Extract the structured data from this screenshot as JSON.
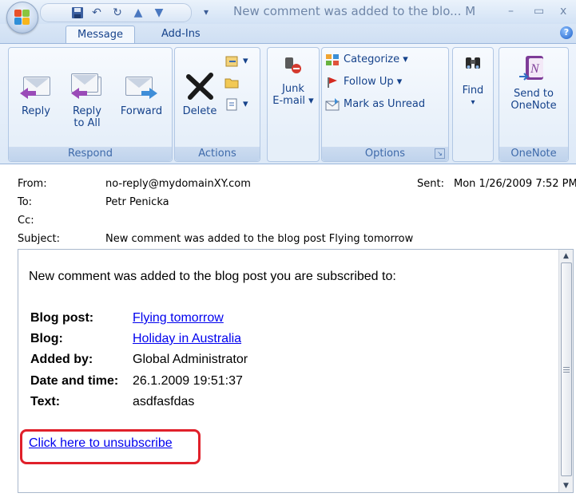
{
  "window": {
    "title": "New comment was added to the blo... M",
    "minimize": "–",
    "maximize": "▭",
    "close": "x"
  },
  "ribbon_tabs": [
    "Message",
    "Add-Ins"
  ],
  "groups": {
    "respond": {
      "label": "Respond",
      "reply": "Reply",
      "reply_all_1": "Reply",
      "reply_all_2": "to All",
      "forward": "Forward"
    },
    "actions": {
      "label": "Actions",
      "delete": "Delete"
    },
    "junk": {
      "line1": "Junk",
      "line2": "E-mail ▾"
    },
    "options": {
      "label": "Options",
      "categorize": "Categorize ▾",
      "follow_up": "Follow Up ▾",
      "mark_unread": "Mark as Unread"
    },
    "find": {
      "label": "Find",
      "arrow": "▾"
    },
    "onenote": {
      "label": "OneNote",
      "line1": "Send to",
      "line2": "OneNote"
    }
  },
  "header": {
    "from_label": "From:",
    "from_value": "no-reply@mydomainXY.com",
    "sent_label": "Sent:",
    "sent_value": "Mon 1/26/2009 7:52 PM",
    "to_label": "To:",
    "to_value": "Petr Penicka",
    "cc_label": "Cc:",
    "subject_label": "Subject:",
    "subject_value": "New comment was added to the blog post Flying tomorrow"
  },
  "body": {
    "intro": "New comment was added to the blog post you are subscribed to:",
    "rows": [
      {
        "label": "Blog post:",
        "value": "Flying tomorrow"
      },
      {
        "label": "Blog:",
        "value": "Holiday in Australia"
      },
      {
        "label": "Added by:",
        "value": "Global Administrator"
      },
      {
        "label": "Date and time:",
        "value": "26.1.2009 19:51:37"
      },
      {
        "label": "Text:",
        "value": "asdfasfdas"
      }
    ],
    "unsubscribe": "Click here to unsubscribe"
  },
  "colors": {
    "link": "#0000ee",
    "highlight": "#e0202a",
    "ribbon_text": "#15428b"
  }
}
